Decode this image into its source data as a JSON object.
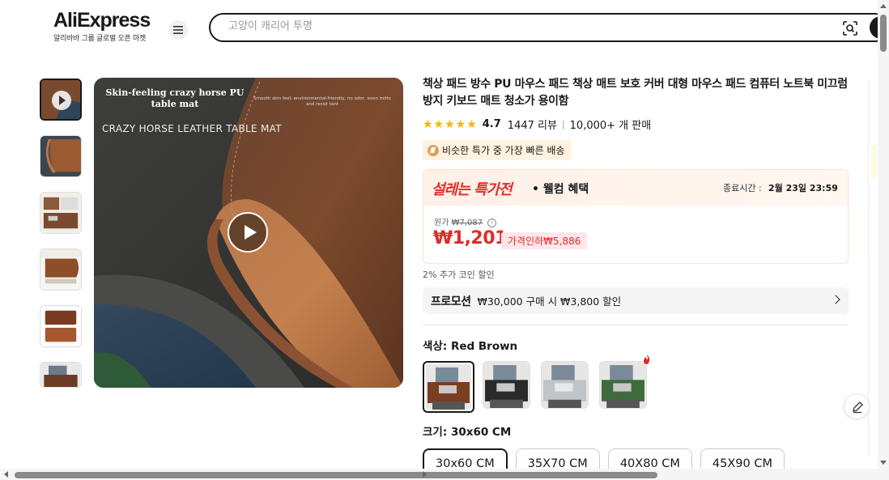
{
  "header": {
    "logo_text": "AliExpress",
    "logo_sub": "알리바바 그룹 글로벌 오픈 마켓",
    "search_placeholder": "고양이 캐리어 투명"
  },
  "gallery": {
    "thumbnail_count": 6,
    "image_title": "Skin-feeling crazy horse PU table mat",
    "image_subtitle": "Smooth skin feel, environmental-friendly, no odor, even mitts and resist tant",
    "image_caption": "CRAZY HORSE LEATHER TABLE MAT"
  },
  "product": {
    "title": "책상 패드 방수 PU 마우스 패드 책상 매트 보호 커버 대형 마우스 패드 컴퓨터 노트북 미끄럼 방지 키보드 매트 청소가 용이함",
    "stars": "★★★★★",
    "rating": "4.7",
    "reviews": "1447 리뷰",
    "sold": "10,000+ 개 판매",
    "fast_badge": "비슷한 특가 중 가장 빠른 배송"
  },
  "deal": {
    "name": "설레는 특가전",
    "suffix": "• 웰컴 혜택",
    "end_label": "종료시간 :",
    "end_value": "2월 23일 23:59",
    "original_label": "원가",
    "original_price": "₩7,087",
    "price": "₩1,201",
    "discount": "가격인하₩5,886"
  },
  "coin_note": "2% 추가 코인 할인",
  "promotion": {
    "tag": "프로모션",
    "text": "₩30,000 구매 시 ₩3,800 할인"
  },
  "color": {
    "label": "색상:",
    "value": "Red Brown",
    "options": [
      "brown",
      "black",
      "gray",
      "green"
    ]
  },
  "size": {
    "label": "크기:",
    "value": "30x60 CM",
    "options": [
      "30x60 CM",
      "35X70 CM",
      "40X80 CM",
      "45X90 CM"
    ]
  },
  "colors_hex": {
    "brand_red": "#e02b27",
    "star": "#f7b500"
  }
}
